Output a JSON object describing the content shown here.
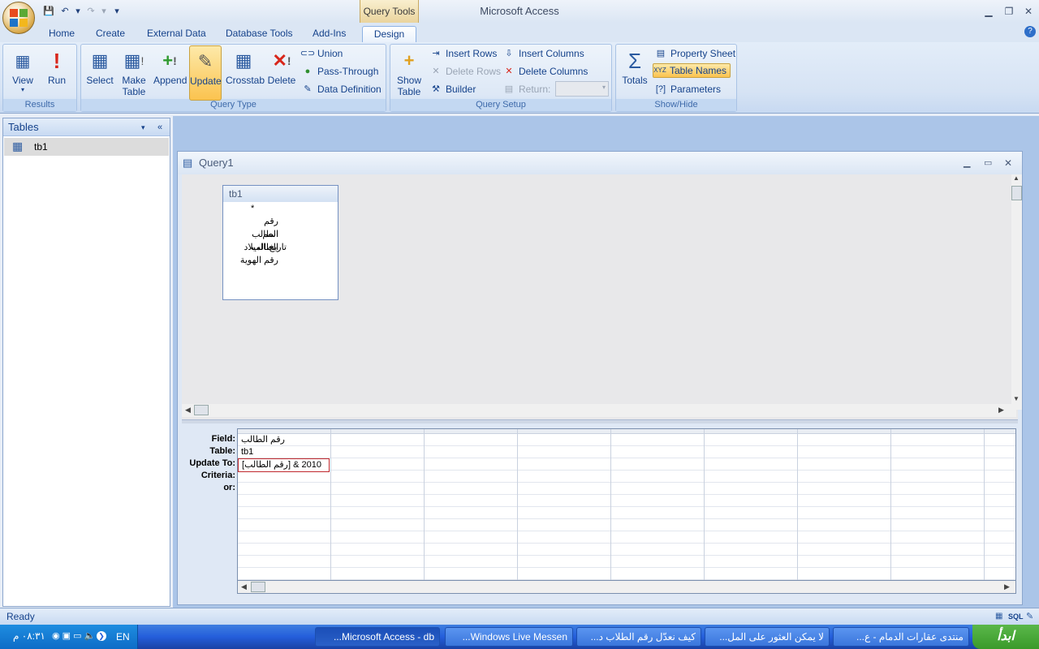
{
  "app": {
    "title": "Microsoft Access",
    "context_tab": "Query Tools"
  },
  "tabs": [
    "Home",
    "Create",
    "External Data",
    "Database Tools",
    "Add-Ins",
    "Design"
  ],
  "ribbon": {
    "results": {
      "label": "Results",
      "view": "View",
      "run": "Run"
    },
    "query_type": {
      "label": "Query Type",
      "select": "Select",
      "make_table_1": "Make",
      "make_table_2": "Table",
      "append": "Append",
      "update": "Update",
      "crosstab": "Crosstab",
      "delete": "Delete",
      "union": "Union",
      "pass_through": "Pass-Through",
      "data_definition": "Data Definition"
    },
    "query_setup": {
      "label": "Query Setup",
      "show_table_1": "Show",
      "show_table_2": "Table",
      "insert_rows": "Insert Rows",
      "delete_rows": "Delete Rows",
      "builder": "Builder",
      "insert_columns": "Insert Columns",
      "delete_columns": "Delete Columns",
      "return": "Return:"
    },
    "show_hide": {
      "label": "Show/Hide",
      "totals": "Totals",
      "property_sheet": "Property Sheet",
      "table_names": "Table Names",
      "parameters": "Parameters"
    }
  },
  "nav": {
    "header": "Tables",
    "items": [
      "tb1"
    ]
  },
  "query": {
    "title": "Query1",
    "table": {
      "name": "tb1",
      "fields": [
        "*",
        "رقم الطالب",
        "اسم الطالب",
        "تاريخ الميلاد",
        "رقم الهوية"
      ]
    },
    "grid_labels": {
      "field": "Field:",
      "table": "Table:",
      "update_to": "Update To:",
      "criteria": "Criteria:",
      "or": "or:"
    },
    "column1": {
      "field": "رقم الطالب",
      "table": "tb1",
      "update_to": "[رقم الطالب] & 2010"
    }
  },
  "status": {
    "text": "Ready",
    "sql": "SQL"
  },
  "taskbar": {
    "start": "ابدأ",
    "lang": "EN",
    "clock": "٠٨:٣١ م",
    "tasks": [
      "Microsoft Access - db...",
      "Windows Live Messen...",
      "كيف نعدّل رقم الطلاب د...",
      "لا يمكن العثور على المل...",
      "منتدى عقارات الدمام - ع..."
    ]
  }
}
